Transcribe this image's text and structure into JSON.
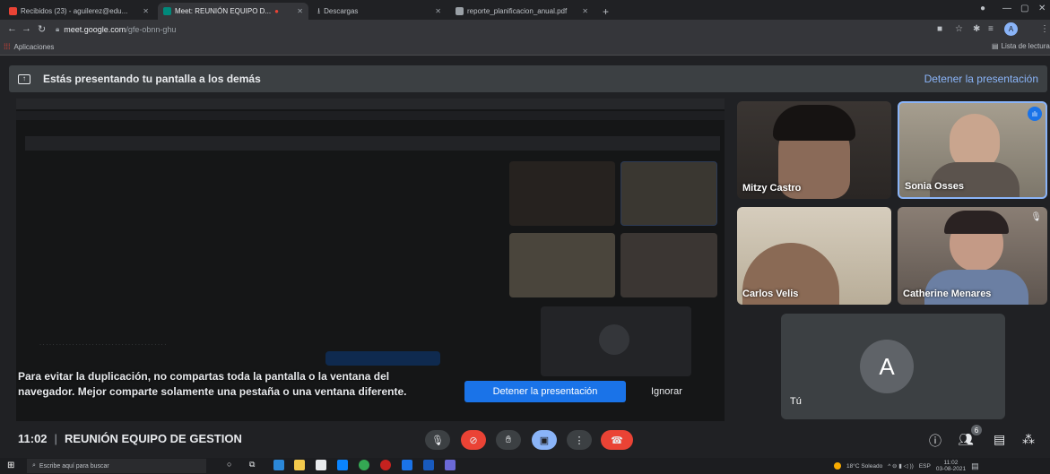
{
  "browser": {
    "tabs": [
      {
        "label": "Recibidos (23) - aguilerez@edu...",
        "favicon": "gmail-icon",
        "color": "#ea4335"
      },
      {
        "label": "Meet: REUNIÓN EQUIPO D...",
        "favicon": "meet-icon",
        "color": "#00897b"
      },
      {
        "label": "Descargas",
        "favicon": "download-icon",
        "color": "#bdc1c6"
      },
      {
        "label": "reporte_planificacion_anual.pdf",
        "favicon": "pdf-icon",
        "color": "#9aa0a6"
      }
    ],
    "url_host": "meet.google.com",
    "url_path": "/gfe-obnn-ghu",
    "bookmarks_label": "Aplicaciones",
    "reading_list": "Lista de lectura",
    "profile_initial": "A"
  },
  "banner": {
    "text": "Estás presentando tu pantalla a los demás",
    "stop_label": "Detener la presentación"
  },
  "notice": {
    "text": "Para evitar la duplicación, no compartas toda la pantalla o la ventana del navegador. Mejor comparte solamente una pestaña o una ventana diferente.",
    "stop_label": "Detener la presentación",
    "ignore_label": "Ignorar"
  },
  "participants": [
    {
      "name": "Mitzy Castro"
    },
    {
      "name": "Sonia Osses",
      "speaking": true
    },
    {
      "name": "Carlos Velis"
    },
    {
      "name": "Catherine Menares",
      "muted": true
    },
    {
      "name": "Tú",
      "initial": "A"
    }
  ],
  "meeting": {
    "time": "11:02",
    "title": "REUNIÓN EQUIPO DE GESTION",
    "participant_count": "6"
  },
  "taskbar": {
    "search_placeholder": "Escribe aquí para buscar",
    "weather": "18°C Soleado",
    "lang": "ESP",
    "time": "11:02",
    "date": "03-08-2021"
  }
}
